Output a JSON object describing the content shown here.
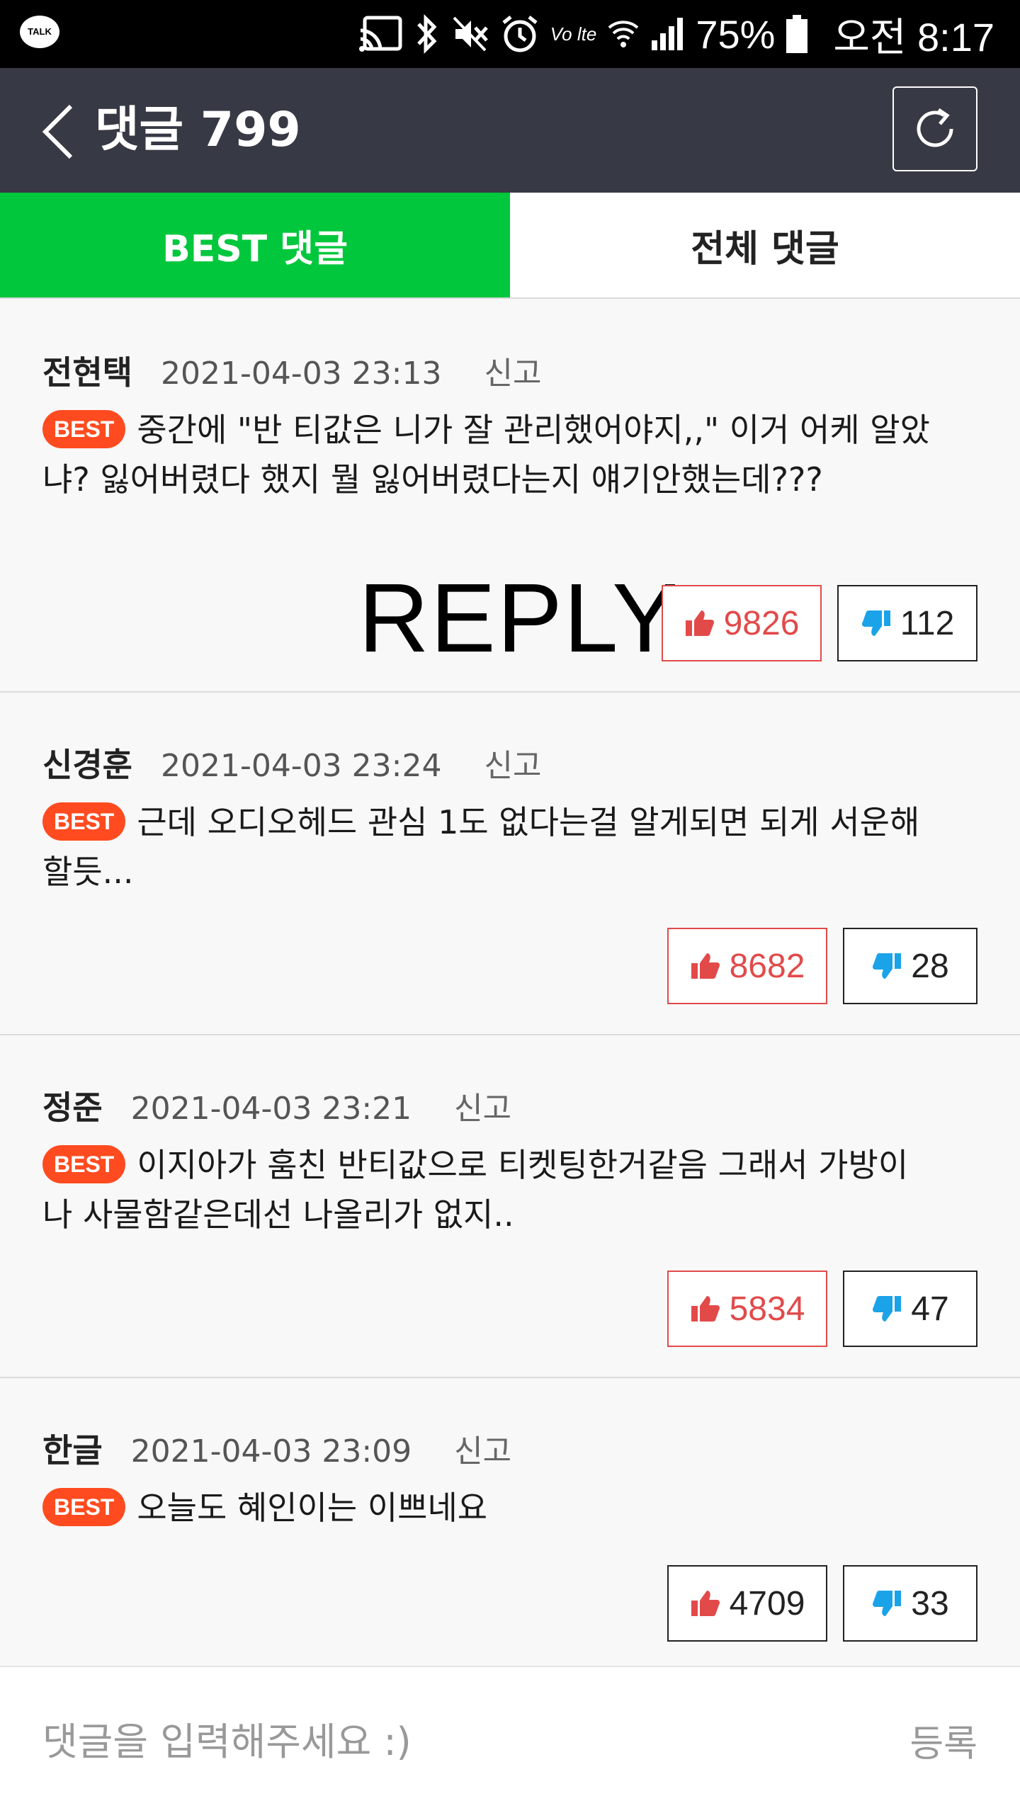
{
  "status_bar": {
    "app_badge": "TALK",
    "battery": "75%",
    "time": "오전 8:17",
    "network_label": "Vo lte"
  },
  "header": {
    "title": "댓글 799"
  },
  "tabs": [
    {
      "label": "BEST 댓글",
      "active": true
    },
    {
      "label": "전체 댓글",
      "active": false
    }
  ],
  "overlay_text": "REPLY",
  "comments": [
    {
      "author": "전현택",
      "date": "2021-04-03 23:13",
      "report": "신고",
      "badge": "BEST",
      "text": "중간에 \"반 티값은 니가 잘 관리했어야지,,\" 이거 어케 알았냐? 잃어버렸다 했지 뭘 잃어버렸다는지 얘기안했는데???",
      "likes": "9826",
      "dislikes": "112"
    },
    {
      "author": "신경훈",
      "date": "2021-04-03 23:24",
      "report": "신고",
      "badge": "BEST",
      "text": "근데 오디오헤드 관심 1도 없다는걸 알게되면 되게 서운해할듯...",
      "likes": "8682",
      "dislikes": "28"
    },
    {
      "author": "정준",
      "date": "2021-04-03 23:21",
      "report": "신고",
      "badge": "BEST",
      "text": "이지아가 훔친 반티값으로 티켓팅한거같음 그래서 가방이나 사물함같은데선 나올리가 없지..",
      "likes": "5834",
      "dislikes": "47"
    },
    {
      "author": "한글",
      "date": "2021-04-03 23:09",
      "report": "신고",
      "badge": "BEST",
      "text": "오늘도 혜인이는 이쁘네요",
      "likes": "4709",
      "dislikes": "33"
    }
  ],
  "input": {
    "placeholder": "댓글을 입력해주세요 :)",
    "submit_label": "등록"
  },
  "colors": {
    "header_bg": "#373a44",
    "tab_active": "#00c73c",
    "badge": "#ff4b1f",
    "like": "#e24a4a",
    "dislike_icon": "#1aa3e8"
  }
}
